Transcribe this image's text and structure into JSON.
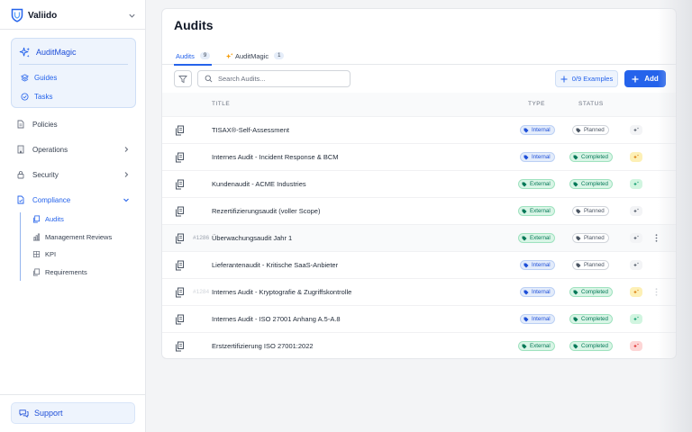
{
  "brand": {
    "name": "Valiido"
  },
  "audit_magic": {
    "title": "AuditMagic",
    "items": [
      {
        "label": "Guides",
        "icon": "stack-icon"
      },
      {
        "label": "Tasks",
        "icon": "check-circle-icon"
      }
    ]
  },
  "nav": {
    "policies": "Policies",
    "operations": "Operations",
    "security": "Security",
    "compliance": "Compliance",
    "compliance_sub": [
      "Audits",
      "Management Reviews",
      "KPI",
      "Requirements"
    ]
  },
  "support": "Support",
  "page": {
    "title": "Audits",
    "tabs": [
      {
        "label": "Audits",
        "count": "9"
      },
      {
        "label": "AuditMagic",
        "count": "1"
      }
    ],
    "search_placeholder": "Search Audits...",
    "examples_label": "0/9 Examples",
    "add_label": "Add"
  },
  "table": {
    "columns": {
      "title": "TITLE",
      "type": "TYPE",
      "status": "STATUS"
    },
    "rows": [
      {
        "id": "",
        "title": "TISAX®-Self-Assessment",
        "type": "Internal",
        "status": "Planned",
        "ai": "grey"
      },
      {
        "id": "",
        "title": "Internes Audit - Incident Response & BCM",
        "type": "Internal",
        "status": "Completed",
        "ai": "yellow"
      },
      {
        "id": "",
        "title": "Kundenaudit - ACME Industries",
        "type": "External",
        "status": "Completed",
        "ai": "green"
      },
      {
        "id": "",
        "title": "Rezertifizierungsaudit (voller Scope)",
        "type": "External",
        "status": "Planned",
        "ai": "grey"
      },
      {
        "id": "#1286",
        "title": "Überwachungsaudit Jahr 1",
        "type": "External",
        "status": "Planned",
        "ai": "grey"
      },
      {
        "id": "",
        "title": "Lieferantenaudit - Kritische SaaS-Anbieter",
        "type": "Internal",
        "status": "Planned",
        "ai": "grey"
      },
      {
        "id": "#1284",
        "title": "Internes Audit - Kryptografie & Zugriffskontrolle",
        "type": "Internal",
        "status": "Completed",
        "ai": "yellow"
      },
      {
        "id": "",
        "title": "Internes Audit - ISO 27001 Anhang A.5-A.8",
        "type": "Internal",
        "status": "Completed",
        "ai": "green"
      },
      {
        "id": "",
        "title": "Erstzertifizierung ISO 27001:2022",
        "type": "External",
        "status": "Completed",
        "ai": "red"
      }
    ]
  }
}
